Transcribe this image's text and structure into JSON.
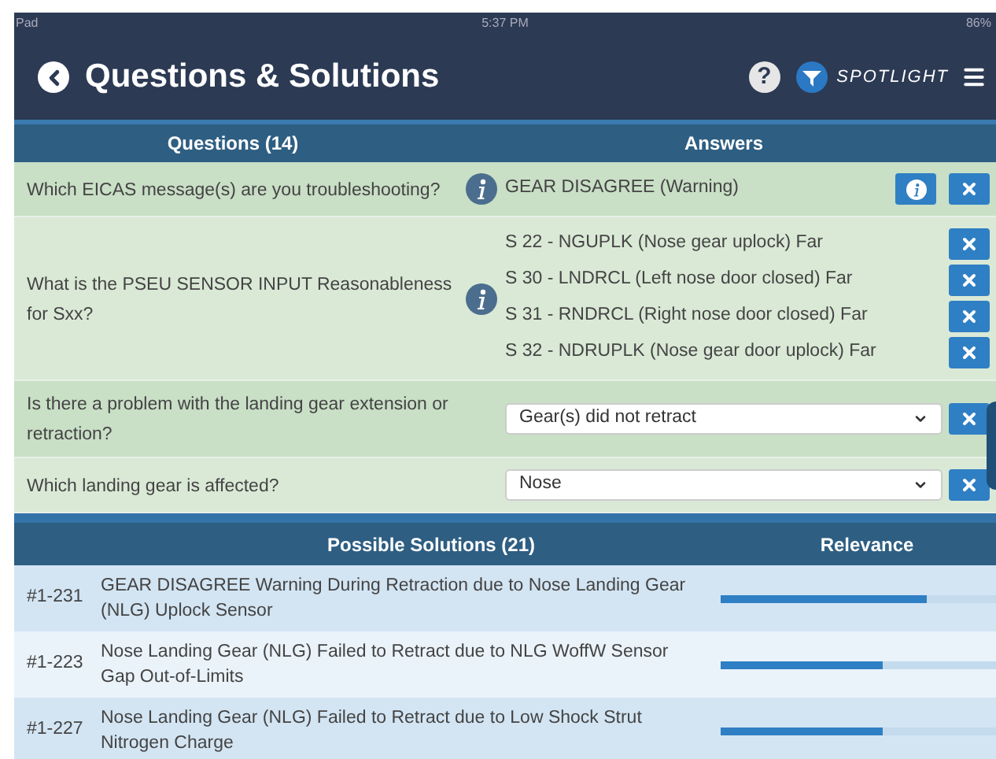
{
  "status_bar": {
    "device": "Pad",
    "time": "5:37 PM",
    "battery": "86%"
  },
  "header": {
    "title": "Questions & Solutions",
    "help": "?",
    "brand": "SPOTLIGHT"
  },
  "questions": {
    "title": "Questions (14)",
    "answers_title": "Answers",
    "items": [
      {
        "kind": "list",
        "question": "Which EICAS message(s) are you troubleshooting?",
        "info": true,
        "answers": [
          {
            "text": "GEAR DISAGREE (Warning)",
            "info": true
          }
        ]
      },
      {
        "kind": "list",
        "question": "What is the PSEU SENSOR INPUT Reasonableness for Sxx?",
        "info": true,
        "answers": [
          {
            "text": "S 22 - NGUPLK (Nose gear uplock) Far",
            "info": false
          },
          {
            "text": "S 30 - LNDRCL (Left nose door closed) Far",
            "info": false
          },
          {
            "text": "S 31 - RNDRCL (Right nose door closed) Far",
            "info": false
          },
          {
            "text": "S 32 - NDRUPLK (Nose gear door uplock) Far",
            "info": false
          }
        ]
      },
      {
        "kind": "select",
        "question": "Is there a problem with the landing gear extension or retraction?",
        "info": false,
        "value": "Gear(s) did not retract"
      },
      {
        "kind": "select",
        "question": "Which landing gear is affected?",
        "info": false,
        "value": "Nose"
      }
    ]
  },
  "solutions": {
    "title": "Possible Solutions (21)",
    "relevance_title": "Relevance",
    "items": [
      {
        "id": "#1-231",
        "text": "GEAR DISAGREE Warning During Retraction due to Nose Landing Gear (NLG) Uplock Sensor",
        "level": 0.75
      },
      {
        "id": "#1-223",
        "text": "Nose Landing Gear (NLG) Failed to Retract due to NLG WoffW Sensor Gap Out-of-Limits",
        "level": 0.59
      },
      {
        "id": "#1-227",
        "text": "Nose Landing Gear (NLG) Failed to Retract due to Low Shock Strut Nitrogen Charge",
        "level": 0.59
      }
    ]
  }
}
